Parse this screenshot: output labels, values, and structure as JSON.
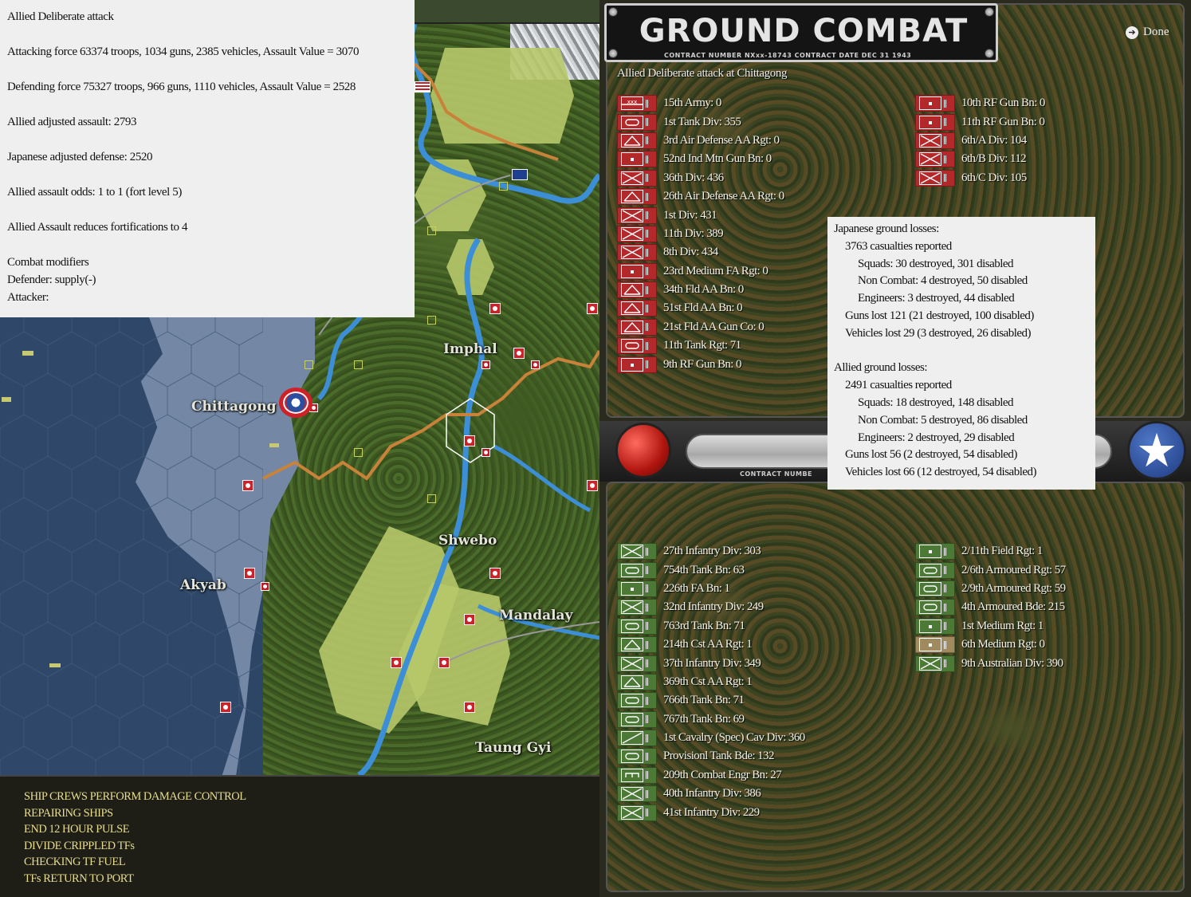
{
  "report": {
    "lines": [
      "Allied Deliberate attack",
      "",
      "Attacking force 63374 troops, 1034 guns, 2385 vehicles, Assault Value = 3070",
      "",
      "Defending force 75327 troops, 966 guns, 1110 vehicles, Assault Value = 2528",
      "",
      "Allied adjusted assault: 2793",
      "",
      "Japanese adjusted defense: 2520",
      "",
      "Allied assault odds: 1 to 1 (fort level 5)",
      "",
      "Allied Assault reduces fortifications to 4",
      "",
      "Combat modifiers",
      "Defender: supply(-)",
      "Attacker:"
    ]
  },
  "map": {
    "cities": [
      "Imphal",
      "Chittagong",
      "Shwebo",
      "Akyab",
      "Mandalay",
      "Taung Gyi"
    ]
  },
  "log": {
    "messages": [
      "SHIP CREWS PERFORM DAMAGE CONTROL",
      "REPAIRING SHIPS",
      "END 12 HOUR PULSE",
      "DIVIDE CRIPPLED TFs",
      "CHECKING TF FUEL",
      "TFs RETURN TO PORT"
    ]
  },
  "panel": {
    "title": "GROUND COMBAT",
    "contract_line": "CONTRACT NUMBER   NXxx-18743          CONTRACT DATE  DEC  31  1943",
    "contract_bottom": "CONTRACT NUMBE",
    "done_label": "Done",
    "subtitle": "Allied Deliberate attack at Chittagong",
    "japanese_col1": [
      {
        "name": "15th Army: 0",
        "icon": "hq"
      },
      {
        "name": "1st Tank Div: 355",
        "icon": "armor"
      },
      {
        "name": "3rd Air Defense AA Rgt: 0",
        "icon": "aa"
      },
      {
        "name": "52nd Ind Mtn Gun Bn: 0",
        "icon": "artillery"
      },
      {
        "name": "36th Div: 436",
        "icon": "infantry"
      },
      {
        "name": "26th Air Defense AA Rgt: 0",
        "icon": "aa"
      },
      {
        "name": "1st Div: 431",
        "icon": "infantry"
      },
      {
        "name": "11th Div: 389",
        "icon": "infantry"
      },
      {
        "name": "8th Div: 434",
        "icon": "infantry"
      },
      {
        "name": "23rd Medium FA Rgt: 0",
        "icon": "artillery"
      },
      {
        "name": "34th Fld AA Bn: 0",
        "icon": "aa"
      },
      {
        "name": "51st Fld AA Bn: 0",
        "icon": "aa"
      },
      {
        "name": "21st Fld AA Gun Co: 0",
        "icon": "aa"
      },
      {
        "name": "11th Tank Rgt: 71",
        "icon": "armor"
      },
      {
        "name": "9th RF Gun Bn: 0",
        "icon": "artillery"
      }
    ],
    "japanese_col2": [
      {
        "name": "10th RF Gun Bn: 0",
        "icon": "artillery"
      },
      {
        "name": "11th RF Gun Bn: 0",
        "icon": "artillery"
      },
      {
        "name": "6th/A Div: 104",
        "icon": "infantry"
      },
      {
        "name": "6th/B Div: 112",
        "icon": "infantry"
      },
      {
        "name": "6th/C Div: 105",
        "icon": "infantry"
      }
    ],
    "allied_col1": [
      {
        "name": "27th Infantry Div: 303",
        "icon": "infantry"
      },
      {
        "name": "754th Tank Bn: 63",
        "icon": "armor"
      },
      {
        "name": "226th FA Bn: 1",
        "icon": "artillery"
      },
      {
        "name": "32nd Infantry Div: 249",
        "icon": "infantry"
      },
      {
        "name": "763rd Tank Bn: 71",
        "icon": "armor"
      },
      {
        "name": "214th Cst AA Rgt: 1",
        "icon": "aa"
      },
      {
        "name": "37th Infantry Div: 349",
        "icon": "infantry"
      },
      {
        "name": "369th Cst AA Rgt: 1",
        "icon": "aa"
      },
      {
        "name": "766th Tank Bn: 71",
        "icon": "armor"
      },
      {
        "name": "767th Tank Bn: 69",
        "icon": "armor"
      },
      {
        "name": "1st Cavalry (Spec) Cav Div: 360",
        "icon": "cavalry"
      },
      {
        "name": "Provisionl Tank Bde: 132",
        "icon": "armor"
      },
      {
        "name": "209th Combat Engr Bn: 27",
        "icon": "engineer"
      },
      {
        "name": "40th Infantry Div: 386",
        "icon": "infantry"
      },
      {
        "name": "41st Infantry Div: 229",
        "icon": "infantry"
      }
    ],
    "allied_col2": [
      {
        "name": "2/11th Field Rgt: 1",
        "icon": "artillery"
      },
      {
        "name": "2/6th Armoured Rgt: 57",
        "icon": "armor"
      },
      {
        "name": "2/9th Armoured Rgt: 59",
        "icon": "armor"
      },
      {
        "name": "4th Armoured Bde: 215",
        "icon": "armor"
      },
      {
        "name": "1st Medium Rgt: 1",
        "icon": "artillery"
      },
      {
        "name": "6th Medium Rgt: 0",
        "icon": "artillery",
        "tan": true
      },
      {
        "name": "9th Australian Div: 390",
        "icon": "infantry"
      }
    ]
  },
  "losses": {
    "lines": [
      {
        "text": "Japanese ground losses:",
        "indent": 0
      },
      {
        "text": "3763 casualties reported",
        "indent": 1
      },
      {
        "text": "Squads: 30 destroyed, 301 disabled",
        "indent": 2
      },
      {
        "text": "Non Combat: 4 destroyed, 50 disabled",
        "indent": 2
      },
      {
        "text": "Engineers: 3 destroyed, 44 disabled",
        "indent": 2
      },
      {
        "text": "Guns lost 121 (21 destroyed, 100 disabled)",
        "indent": 1
      },
      {
        "text": "Vehicles lost 29 (3 destroyed, 26 disabled)",
        "indent": 1
      },
      {
        "text": "",
        "indent": 0
      },
      {
        "text": "Allied ground losses:",
        "indent": 0
      },
      {
        "text": "2491 casualties reported",
        "indent": 1
      },
      {
        "text": "Squads: 18 destroyed, 148 disabled",
        "indent": 2
      },
      {
        "text": "Non Combat: 5 destroyed, 86 disabled",
        "indent": 2
      },
      {
        "text": "Engineers: 2 destroyed, 29 disabled",
        "indent": 2
      },
      {
        "text": "Guns lost 56 (2 destroyed, 54 disabled)",
        "indent": 1
      },
      {
        "text": "Vehicles lost 66 (12 destroyed, 54 disabled)",
        "indent": 1
      }
    ]
  },
  "colors": {
    "japanese_unit": "#b3282a",
    "allied_unit": "#4c7a36",
    "log_text": "#e7dc8e",
    "hex_border": "#c9823a",
    "river": "#3c8fd6"
  }
}
